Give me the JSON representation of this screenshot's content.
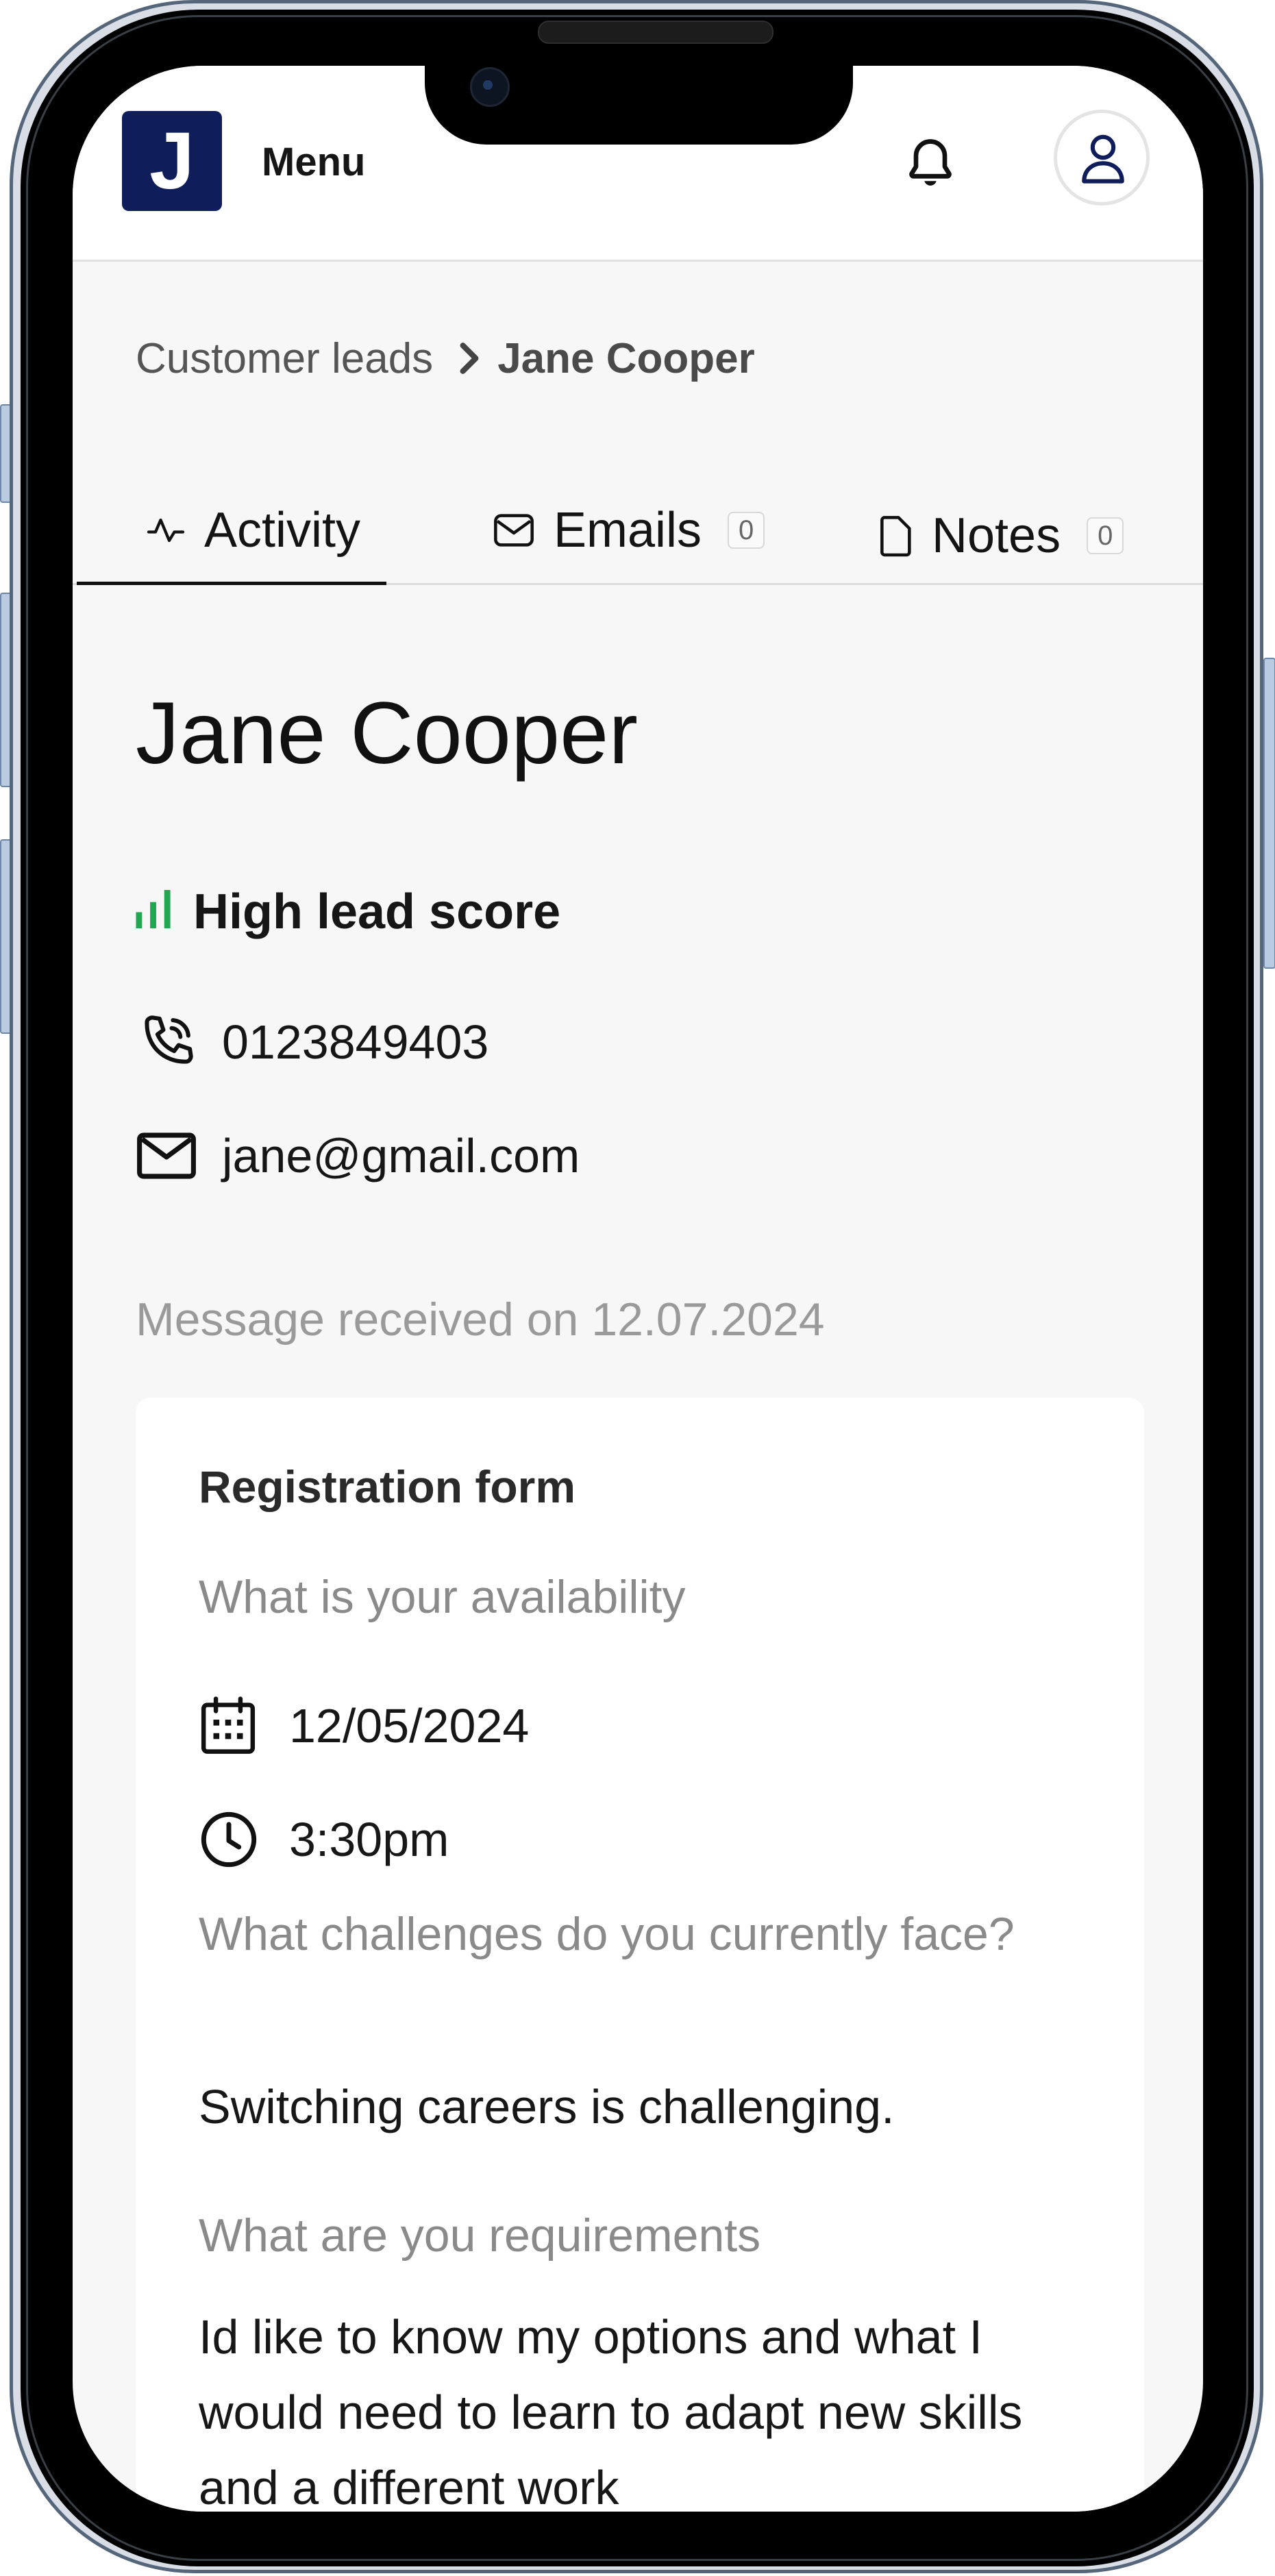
{
  "header": {
    "logo_letter": "J",
    "menu_label": "Menu"
  },
  "breadcrumb": {
    "parent": "Customer leads",
    "current": "Jane Cooper"
  },
  "tabs": [
    {
      "label": "Activity",
      "icon": "activity-icon",
      "active": true
    },
    {
      "label": "Emails",
      "icon": "mail-icon",
      "count": "0"
    },
    {
      "label": "Notes",
      "icon": "file-icon",
      "count": "0"
    }
  ],
  "lead": {
    "name": "Jane Cooper",
    "score_label": "High lead score",
    "phone": "0123849403",
    "email": "jane@gmail.com",
    "received": "Message received on 12.07.2024"
  },
  "form": {
    "title": "Registration form",
    "q1": "What is your availability",
    "date": "12/05/2024",
    "time": "3:30pm",
    "q2": "What challenges do you currently face?",
    "a2": "Switching careers is challenging.",
    "q3": "What are you requirements",
    "a3": "Id like to know my options and what I would need to learn to adapt new skills and a different work"
  },
  "colors": {
    "brand": "#0f1e5a",
    "score": "#22a652"
  }
}
